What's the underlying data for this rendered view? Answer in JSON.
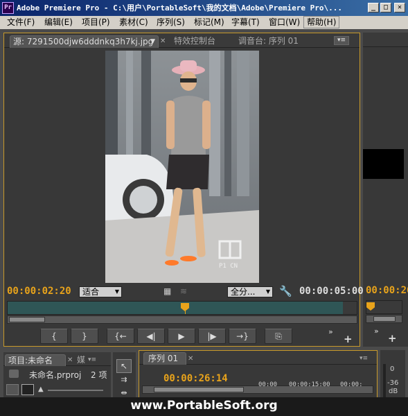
{
  "window": {
    "app_badge": "Pr",
    "title": "Adobe Premiere Pro - C:\\用户\\PortableSoft\\我的文档\\Adobe\\Premiere Pro\\..."
  },
  "menu": [
    "文件(F)",
    "编辑(E)",
    "项目(P)",
    "素材(C)",
    "序列(S)",
    "标记(M)",
    "字幕(T)",
    "窗口(W)",
    "帮助(H)"
  ],
  "source_monitor": {
    "tabs": [
      "源: 7291500djw6dddnkq3h7kj.jpg",
      "特效控制台",
      "调音台: 序列 01"
    ],
    "current_time": "00:00:02:20",
    "zoom_value": "适合",
    "resolution_value": "全分...",
    "duration": "00:00:05:00",
    "watermark_text": "P1 CN",
    "transport": [
      "{",
      "}",
      "{←",
      "◀|",
      "▶",
      "|▶",
      "→}",
      "⎘"
    ]
  },
  "program_monitor": {
    "current_time": "00:00:26"
  },
  "project_panel": {
    "tab": "项目:未命名",
    "tab2": "媒",
    "file": "未命名.prproj",
    "count": "2 项"
  },
  "sequence_panel": {
    "tab": "序列 01",
    "current_time": "00:00:26:14",
    "ruler": [
      "00:00",
      "00:00:15:00",
      "00:00:"
    ]
  },
  "audio_meter": {
    "labels": [
      "0",
      "-36",
      "dB"
    ]
  },
  "watermark": "www.PortableSoft.org"
}
